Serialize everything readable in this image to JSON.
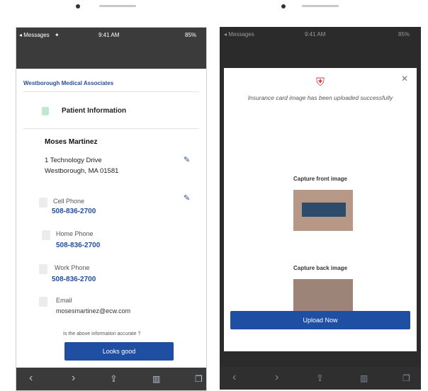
{
  "left_screen": {
    "status": {
      "carrier": "◂ Messages",
      "time": "9:41 AM",
      "battery": "85%"
    },
    "org_name": "Westborough Medical Associates",
    "section_title": "Patient Information",
    "patient": {
      "name": "Moses Martinez",
      "address_line1": "1 Technology Drive",
      "address_line2": "Westborough, MA 01581"
    },
    "contacts": [
      {
        "label": "Cell Phone",
        "value": "508-836-2700"
      },
      {
        "label": "Home Phone",
        "value": "508-836-2700"
      },
      {
        "label": "Work Phone",
        "value": "508-836-2700"
      }
    ],
    "email_label": "Email",
    "email_value": "mosesmartinez@ecw.com",
    "question": "Is the above information accurate ?",
    "confirm_button": "Looks good"
  },
  "right_screen": {
    "status": {
      "carrier": "◂ Messages",
      "time": "9:41 AM",
      "battery": "85%"
    },
    "success_message": "Insurance card image has been uploaded successfully",
    "front_label": "Capture front image",
    "back_label": "Capture back image",
    "upload_button": "Upload Now"
  },
  "colors": {
    "brand_blue": "#1f4fa3",
    "alert_red": "#d63b3b"
  }
}
